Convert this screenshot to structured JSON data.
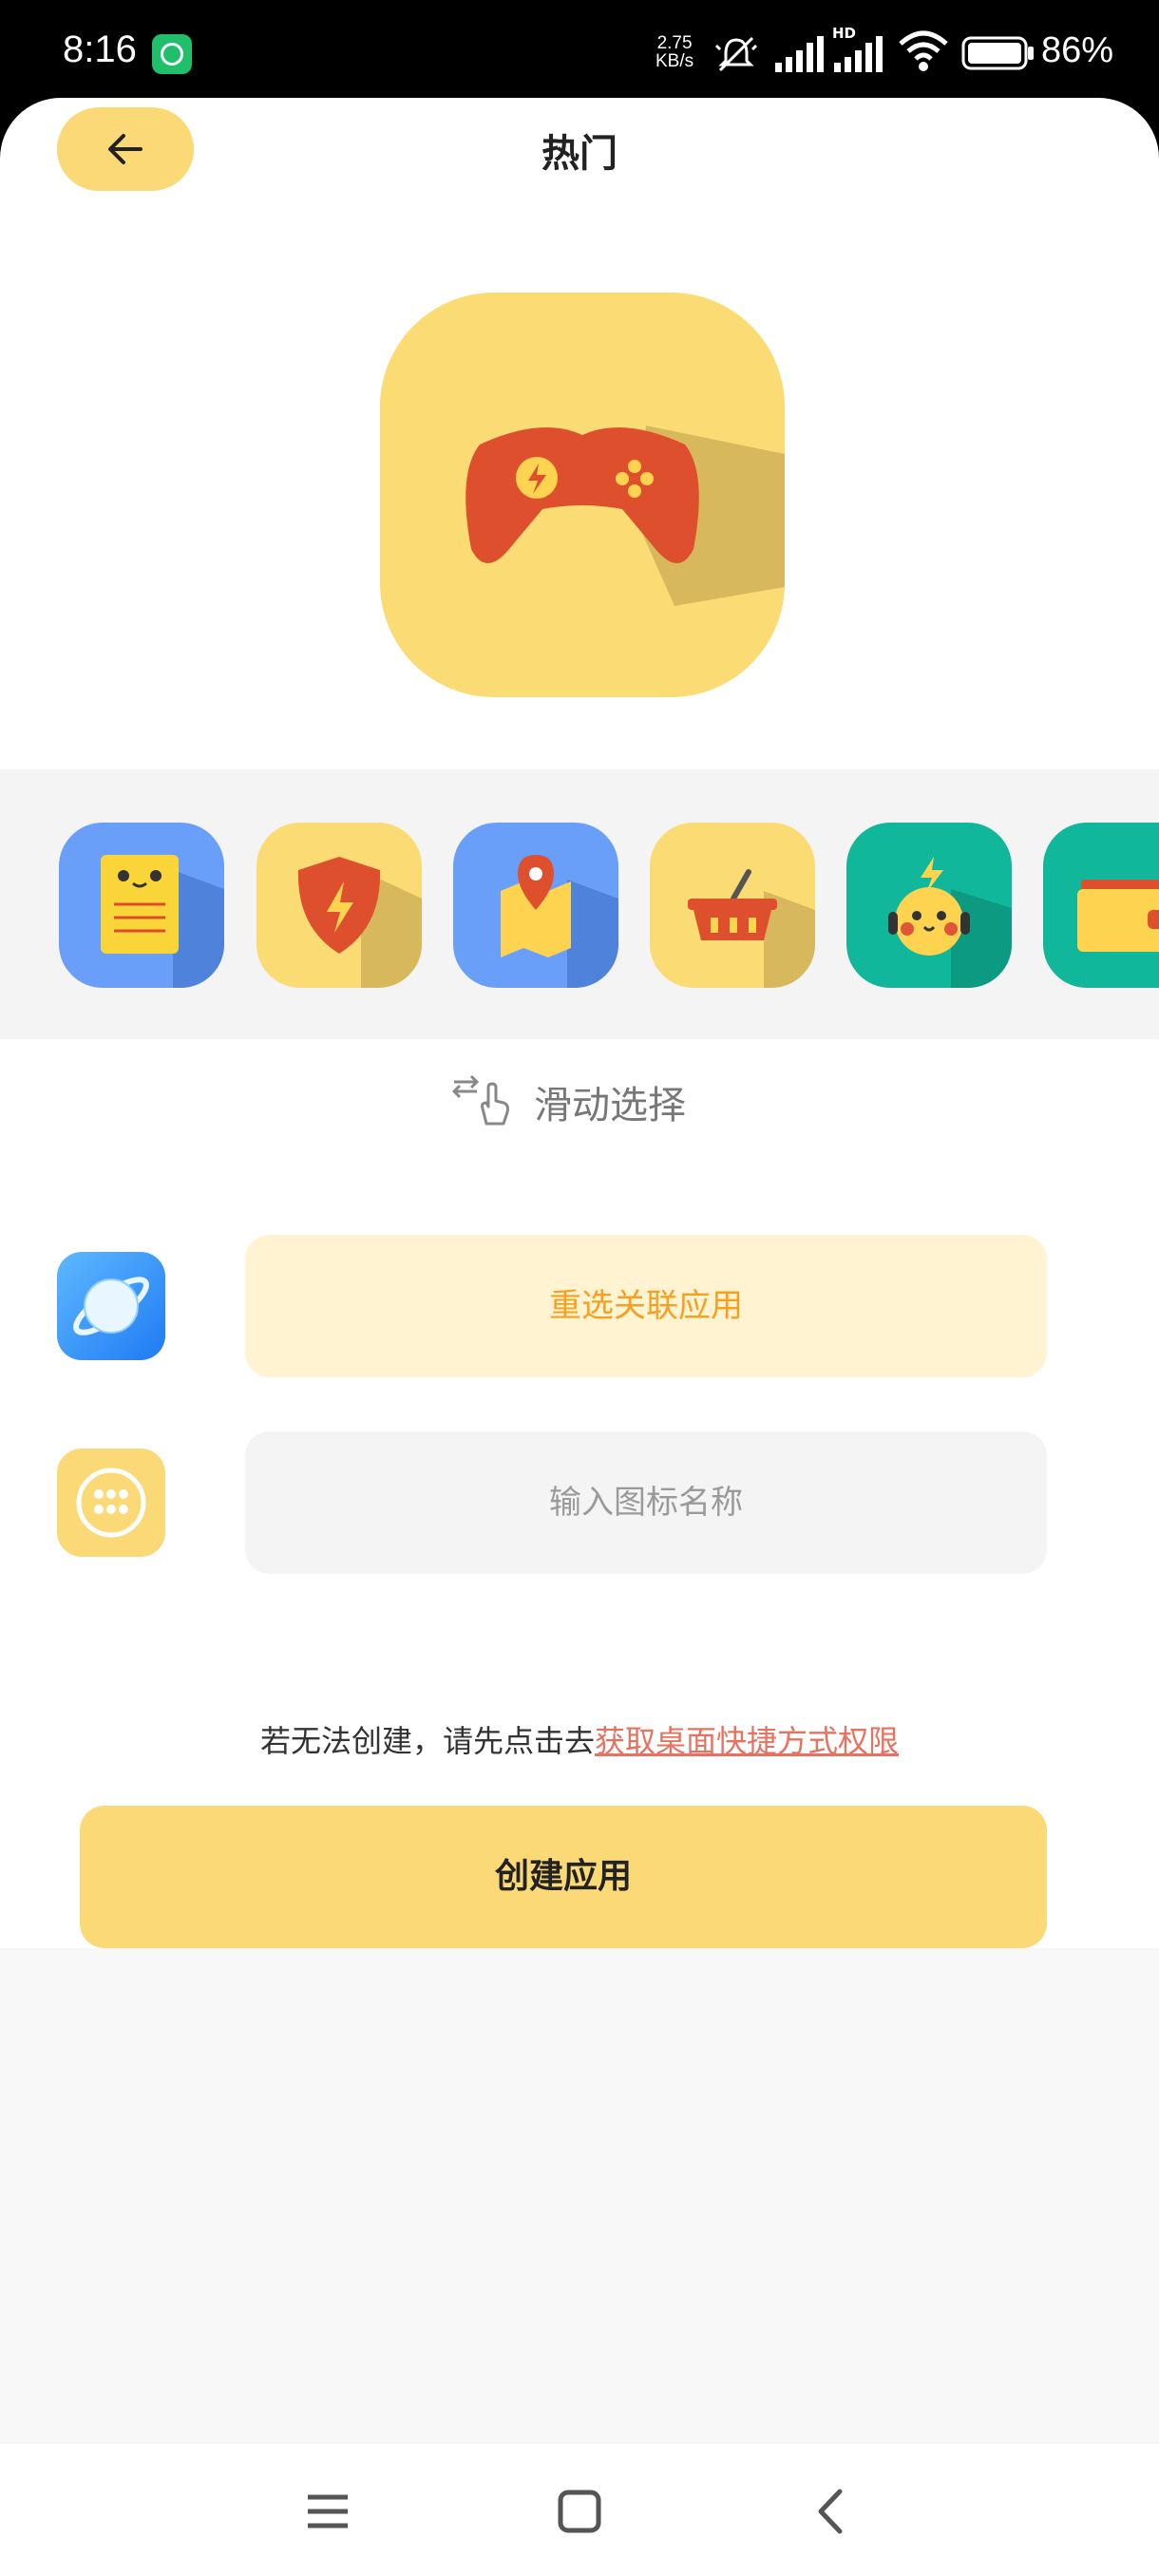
{
  "status_bar": {
    "time": "8:16",
    "net_speed_value": "2.75",
    "net_speed_unit": "KB/s",
    "hd_label": "HD",
    "battery_percent": "86%",
    "battery_level": 0.86
  },
  "header": {
    "title": "热门",
    "back_icon": "arrow-left-icon"
  },
  "preview": {
    "icon": "gamepad-icon",
    "background": "#fbdc74"
  },
  "icon_strip": {
    "items": [
      {
        "icon": "notebook-face-icon",
        "background": "#6a9ff9"
      },
      {
        "icon": "shield-bolt-icon",
        "background": "#fbdc74"
      },
      {
        "icon": "map-pin-icon",
        "background": "#6a9ff9"
      },
      {
        "icon": "basket-icon",
        "background": "#fbdc74"
      },
      {
        "icon": "pikachu-icon",
        "background": "#10b79a"
      },
      {
        "icon": "wallet-icon",
        "background": "#10b79a"
      }
    ]
  },
  "swipe_hint": {
    "label": "滑动选择",
    "icon": "swipe-hand-icon"
  },
  "linked_app": {
    "icon": "planet-browser-icon",
    "button_label": "重选关联应用"
  },
  "name_field": {
    "icon": "keypad-icon",
    "placeholder": "输入图标名称",
    "value": ""
  },
  "notice": {
    "text": "若无法创建，请先点击去",
    "link": "获取桌面快捷方式权限"
  },
  "create_button": {
    "label": "创建应用"
  },
  "nav_bar": {
    "menu_icon": "menu-icon",
    "home_icon": "home-square-icon",
    "back_icon": "back-chevron-icon"
  },
  "colors": {
    "accent_yellow": "#fcd977",
    "accent_orange": "#f5a020",
    "link_red": "#e8715f"
  }
}
